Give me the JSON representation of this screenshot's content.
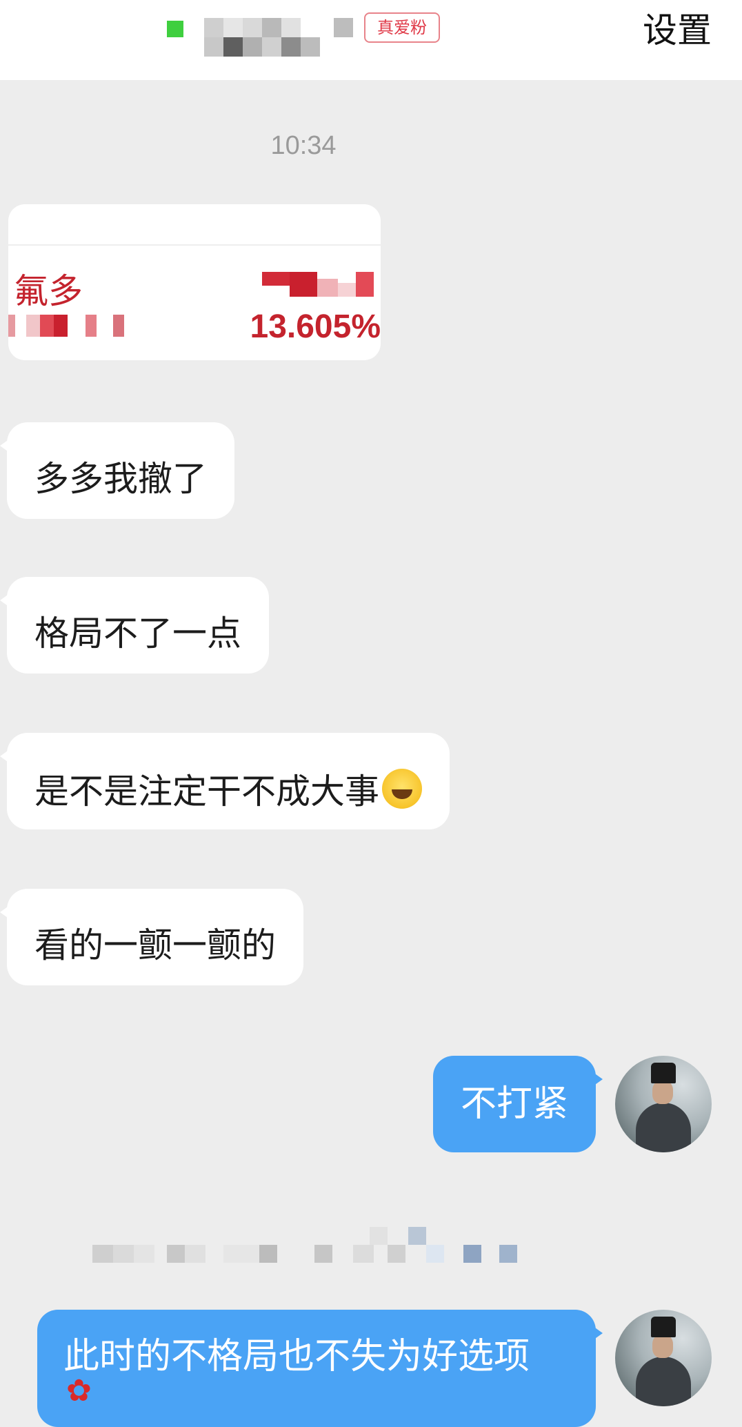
{
  "header": {
    "badge": "真爱粉",
    "settings_label": "设置"
  },
  "chat": {
    "timestamp": "10:34",
    "shared_image": {
      "stock_name": "氟多",
      "percent": "13.605%"
    },
    "messages": [
      {
        "side": "left",
        "text": "多多我撤了"
      },
      {
        "side": "left",
        "text": "格局不了一点"
      },
      {
        "side": "left",
        "text": "是不是注定干不成大事",
        "emoji": "rolling-laughing-emoji"
      },
      {
        "side": "left",
        "text": "看的一颤一颤的"
      },
      {
        "side": "right",
        "text": "不打紧"
      },
      {
        "side": "right",
        "text": "此时的不格局也不失为好选项",
        "emoji": "rose-emoji"
      }
    ]
  },
  "colors": {
    "background": "#ededed",
    "outgoing_bubble": "#4aa3f5",
    "incoming_bubble": "#ffffff",
    "online_indicator": "#3fcf3f",
    "badge_red": "#e03a48"
  }
}
